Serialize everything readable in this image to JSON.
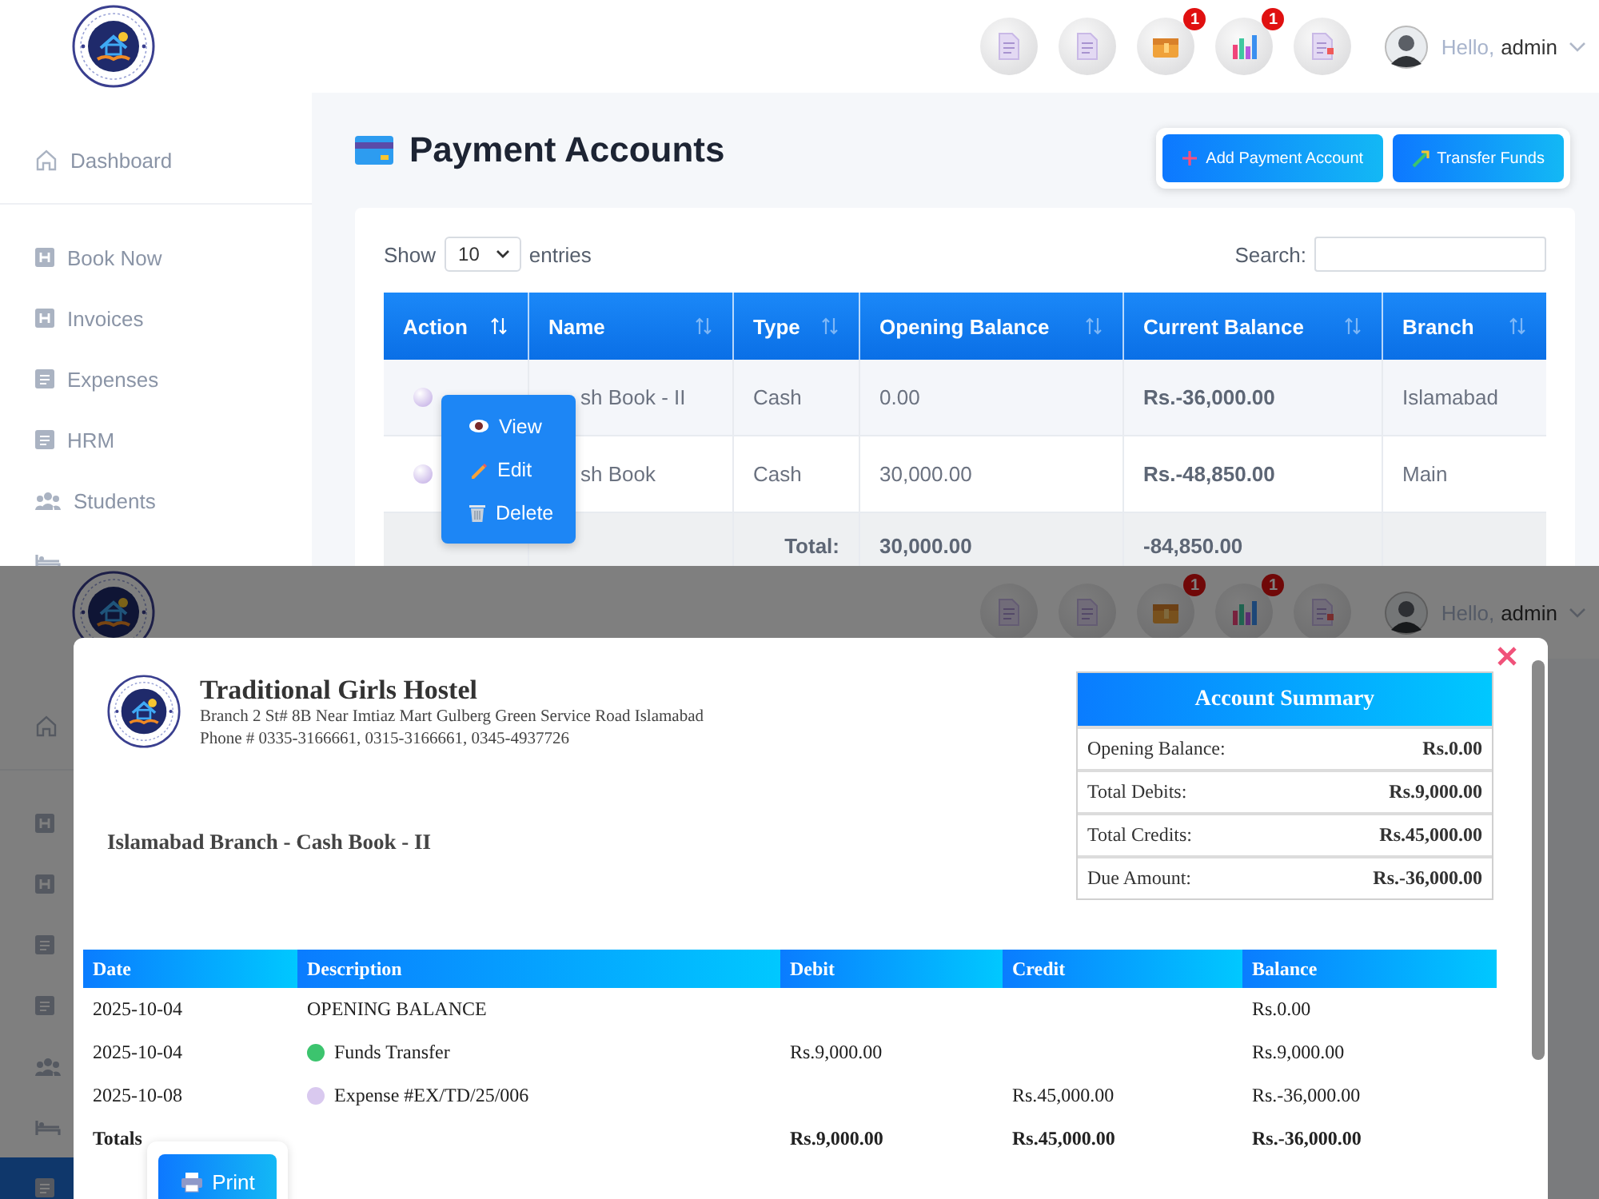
{
  "app_view": {
    "header": {
      "buttons": [
        {
          "kind": "document"
        },
        {
          "kind": "document"
        },
        {
          "kind": "wallet",
          "badge": "1"
        },
        {
          "kind": "chart",
          "badge": "1"
        },
        {
          "kind": "report"
        }
      ],
      "greeting": "Hello,",
      "user": "admin"
    },
    "sidebar": {
      "items": [
        {
          "kind": "home",
          "label": "Dashboard"
        },
        {
          "kind": "h",
          "label": "Book Now"
        },
        {
          "kind": "h",
          "label": "Invoices"
        },
        {
          "kind": "book",
          "label": "Expenses"
        },
        {
          "kind": "book",
          "label": "HRM"
        },
        {
          "kind": "users",
          "label": "Students"
        },
        {
          "kind": "bed"
        }
      ]
    },
    "page_title": "Payment Accounts",
    "actions": [
      {
        "kind": "add",
        "label": "Add Payment Account"
      },
      {
        "kind": "transfer",
        "label": "Transfer Funds"
      }
    ],
    "table_controls": {
      "show_label": "Show",
      "page_size": "10",
      "entries_label": "entries",
      "search_label": "Search:"
    },
    "table": {
      "columns": [
        {
          "label": "Action",
          "sorted": true
        },
        {
          "label": "Name",
          "sorted": false
        },
        {
          "label": "Type",
          "sorted": false
        },
        {
          "label": "Opening Balance",
          "sorted": false
        },
        {
          "label": "Current Balance",
          "sorted": false
        },
        {
          "label": "Branch",
          "sorted": false
        }
      ],
      "rows": [
        {
          "name": "sh Book - II",
          "type": "Cash",
          "opening_balance": "0.00",
          "current_balance": "Rs.-36,000.00",
          "branch": "Islamabad"
        },
        {
          "name": "sh Book",
          "type": "Cash",
          "opening_balance": "30,000.00",
          "current_balance": "Rs.-48,850.00",
          "branch": "Main"
        }
      ],
      "total": {
        "label": "Total:",
        "opening_balance": "30,000.00",
        "current_balance": "-84,850.00"
      }
    },
    "action_menu": {
      "items": [
        {
          "kind": "view",
          "label": "View"
        },
        {
          "kind": "edit",
          "label": "Edit"
        },
        {
          "kind": "delete",
          "label": "Delete"
        }
      ]
    }
  },
  "report_view": {
    "header": {
      "buttons": [
        {
          "kind": "document"
        },
        {
          "kind": "document"
        },
        {
          "kind": "wallet",
          "badge": "1"
        },
        {
          "kind": "chart",
          "badge": "1"
        },
        {
          "kind": "report"
        }
      ],
      "greeting": "Hello,",
      "user": "admin"
    },
    "sidebar": {
      "items": [
        {
          "kind": "home",
          "selected": false
        },
        {
          "kind": "h",
          "selected": false
        },
        {
          "kind": "h",
          "selected": false
        },
        {
          "kind": "book",
          "selected": false
        },
        {
          "kind": "book",
          "selected": false
        },
        {
          "kind": "users",
          "selected": false
        },
        {
          "kind": "bed",
          "selected": false
        },
        {
          "kind": "book",
          "selected": true
        }
      ]
    },
    "modal": {
      "company": {
        "name": "Traditional Girls Hostel",
        "address": "Branch 2 St# 8B Near Imtiaz Mart Gulberg Green Service Road Islamabad",
        "phone": "Phone # 0335-3166661, 0315-3166661, 0345-4937726"
      },
      "account_title": "Islamabad Branch - Cash Book - II",
      "summary": {
        "title": "Account Summary",
        "rows": [
          {
            "label": "Opening Balance:",
            "value": "Rs.0.00"
          },
          {
            "label": "Total Debits:",
            "value": "Rs.9,000.00"
          },
          {
            "label": "Total Credits:",
            "value": "Rs.45,000.00"
          },
          {
            "label": "Due Amount:",
            "value": "Rs.-36,000.00"
          }
        ]
      },
      "ledger": {
        "columns": [
          "Date",
          "Description",
          "Debit",
          "Credit",
          "Balance"
        ],
        "rows": [
          {
            "date": "2025-10-04",
            "description": "OPENING BALANCE",
            "balance": "Rs.0.00"
          },
          {
            "date": "2025-10-04",
            "description": "Funds Transfer",
            "color": "#3cc46e",
            "debit": "Rs.9,000.00",
            "balance": "Rs.9,000.00"
          },
          {
            "date": "2025-10-08",
            "description": "Expense #EX/TD/25/006",
            "color": "#d9c9ef",
            "credit": "Rs.45,000.00",
            "balance": "Rs.-36,000.00"
          }
        ],
        "totals": {
          "label": "Totals",
          "debit": "Rs.9,000.00",
          "credit": "Rs.45,000.00",
          "balance": "Rs.-36,000.00"
        }
      },
      "print_label": "Print"
    }
  }
}
